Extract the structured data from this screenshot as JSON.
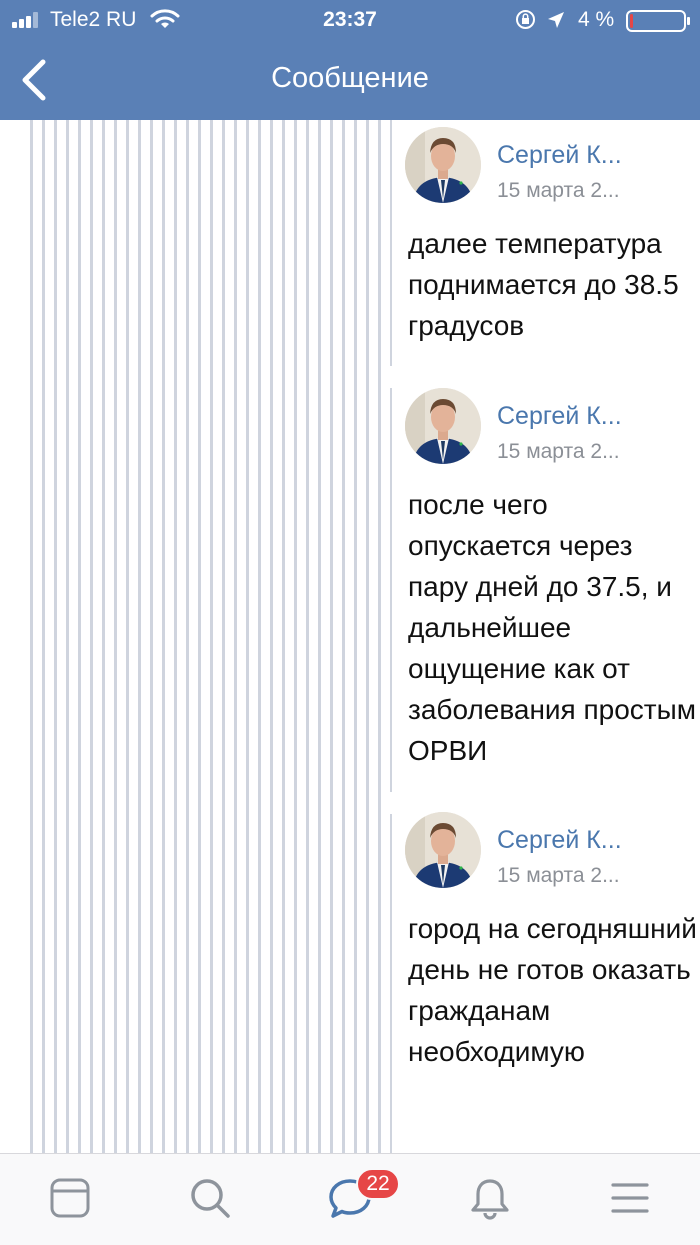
{
  "status_bar": {
    "carrier": "Tele2 RU",
    "time": "23:37",
    "battery_percent": "4 %",
    "battery_level": 0.04,
    "icons": [
      "signal-icon",
      "wifi-icon",
      "rotation-lock-icon",
      "location-arrow-icon",
      "battery-icon"
    ]
  },
  "nav": {
    "title": "Сообщение",
    "back_icon": "chevron-left-icon"
  },
  "colors": {
    "header": "#5a80b6",
    "author": "#4a77ad",
    "badge": "#e64646",
    "tab_icon": "#8e949c",
    "active_tab": "#4a77ad"
  },
  "messages": [
    {
      "author": "Сергей К...",
      "date": "15 марта 2...",
      "text": "далее температура поднимается до 38.5 градусов"
    },
    {
      "author": "Сергей К...",
      "date": "15 марта 2...",
      "text": "после чего опускается через пару дней до 37.5, и дальнейшее ощущение как от заболевания простым ОРВИ"
    },
    {
      "author": "Сергей К...",
      "date": "15 марта 2...",
      "text": "город на сегодняшний день не готов оказать гражданам необходимую"
    }
  ],
  "tabbar": {
    "items": [
      {
        "icon": "news-feed-icon"
      },
      {
        "icon": "search-icon"
      },
      {
        "icon": "messages-icon",
        "badge": "22",
        "active": true
      },
      {
        "icon": "bell-icon"
      },
      {
        "icon": "menu-icon"
      }
    ]
  }
}
